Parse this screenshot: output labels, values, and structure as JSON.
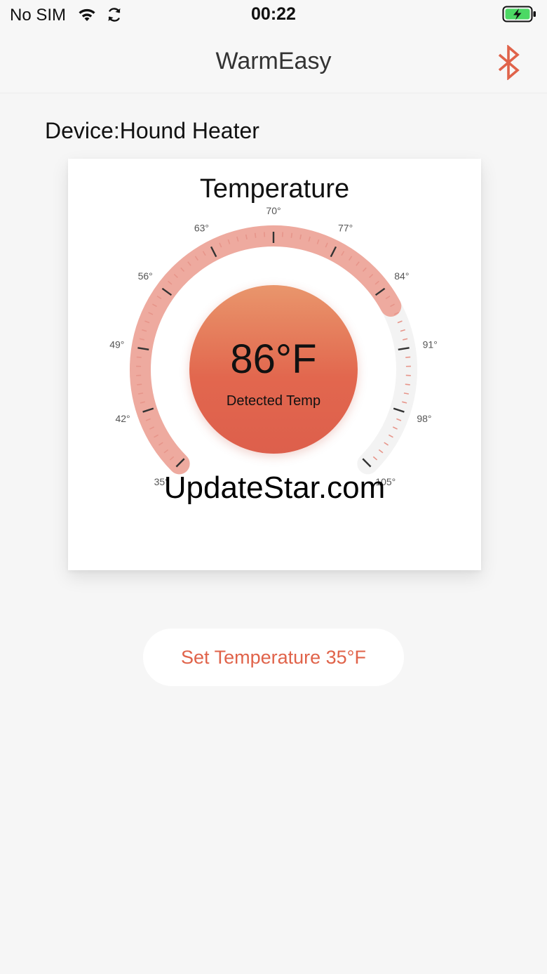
{
  "status_bar": {
    "carrier": "No SIM",
    "time": "00:22",
    "wifi_icon": "wifi-icon",
    "sync_icon": "sync-icon",
    "battery_icon": "battery-charging-icon",
    "battery_color": "#4cd964"
  },
  "nav": {
    "title": "WarmEasy",
    "bluetooth_icon": "bluetooth-icon",
    "bluetooth_color": "#e0634a"
  },
  "device": {
    "label": "Device:Hound Heater"
  },
  "card": {
    "title": "Temperature",
    "gauge": {
      "min": 35,
      "max": 105,
      "set_value": 86,
      "labels": [
        {
          "text": "35°",
          "value": 35
        },
        {
          "text": "42°",
          "value": 42
        },
        {
          "text": "49°",
          "value": 49
        },
        {
          "text": "56°",
          "value": 56
        },
        {
          "text": "63°",
          "value": 63
        },
        {
          "text": "70°",
          "value": 70
        },
        {
          "text": "77°",
          "value": 77
        },
        {
          "text": "84°",
          "value": 84
        },
        {
          "text": "91°",
          "value": 91
        },
        {
          "text": "98°",
          "value": 98
        },
        {
          "text": "105°",
          "value": 105
        }
      ],
      "fill_color": "#eeaa9f",
      "track_color": "#f3f3f3",
      "minor_tick_color": "#e7958a",
      "major_tick_color": "#333333"
    },
    "detected_temp": "86°F",
    "detected_caption": "Detected Temp",
    "circle_color_top": "#e9966c",
    "circle_color_bottom": "#dd5f4c"
  },
  "watermark": "UpdateStar.com",
  "set_temp_button": {
    "label": "Set Temperature 35°F"
  }
}
